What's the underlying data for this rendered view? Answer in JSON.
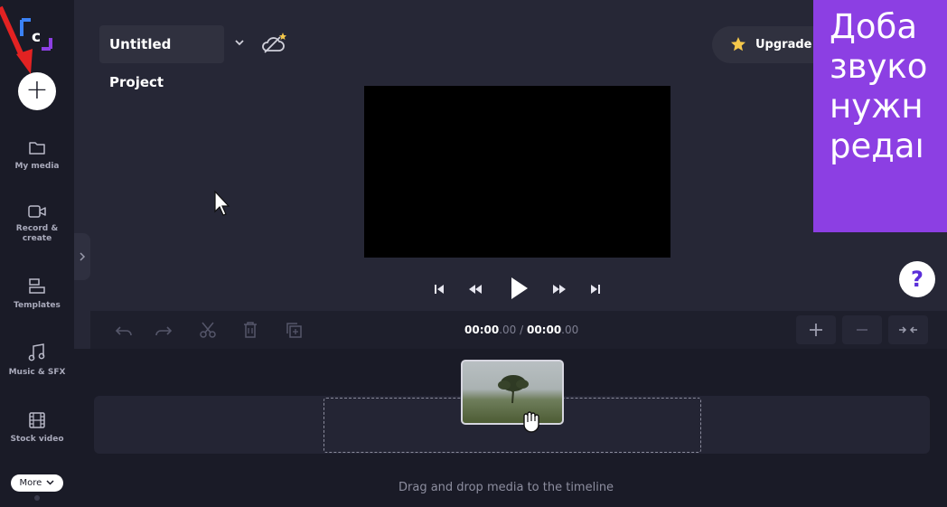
{
  "app": {
    "logo_letter": "c",
    "colors": {
      "accent": "#8c3fe3",
      "sidebar": "#1a1b27",
      "panel": "#262736",
      "star": "#f5c84b",
      "annotation_arrow": "#e32222"
    }
  },
  "sidebar": {
    "add_label": "+",
    "items": [
      {
        "label": "My media",
        "icon": "folder-icon"
      },
      {
        "label": "Record & create",
        "icon": "camera-icon"
      },
      {
        "label": "Templates",
        "icon": "templates-icon"
      },
      {
        "label": "Music & SFX",
        "icon": "music-note-icon"
      },
      {
        "label": "Stock video",
        "icon": "film-icon"
      }
    ],
    "more_label": "More"
  },
  "header": {
    "project_title": "Untitled Project",
    "upgrade_label": "Upgrade"
  },
  "overlay": {
    "lines": [
      "Доба",
      "звуко",
      "нужн",
      "редаı"
    ]
  },
  "player": {
    "help_label": "?"
  },
  "timeline": {
    "current_time_main": "00:00",
    "current_time_frac": ".00",
    "separator": " / ",
    "total_time_main": "00:00",
    "total_time_frac": ".00",
    "drop_hint": "Drag and drop media to the timeline"
  }
}
